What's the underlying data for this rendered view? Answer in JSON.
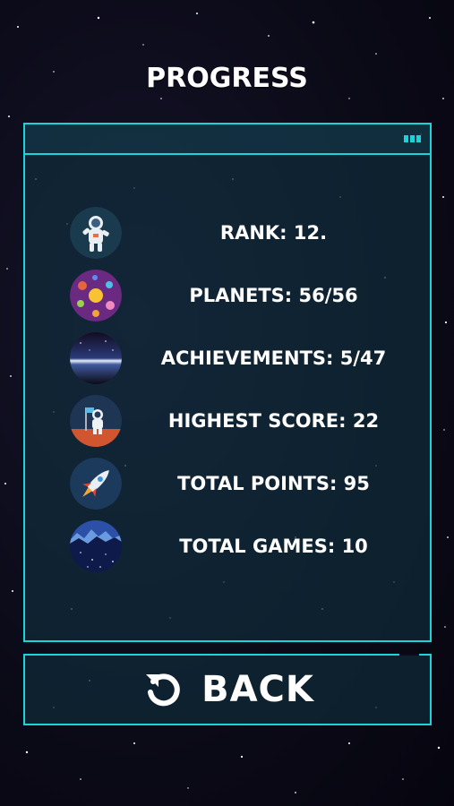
{
  "screen": {
    "title": "PROGRESS"
  },
  "stats": [
    {
      "label": "RANK: 12.",
      "icon": "astronaut-icon"
    },
    {
      "label": "PLANETS: 56/56",
      "icon": "planets-icon"
    },
    {
      "label": "ACHIEVEMENTS: 5/47",
      "icon": "horizon-icon"
    },
    {
      "label": "HIGHEST SCORE: 22",
      "icon": "astronaut-flag-icon"
    },
    {
      "label": "TOTAL POINTS: 95",
      "icon": "rocket-icon"
    },
    {
      "label": "TOTAL GAMES: 10",
      "icon": "night-sky-icon"
    }
  ],
  "back_button": {
    "label": "BACK",
    "icon": "restart-arrow-icon"
  },
  "colors": {
    "accent": "#19d4d9",
    "panel": "#103444",
    "background": "#0d0b1a"
  }
}
